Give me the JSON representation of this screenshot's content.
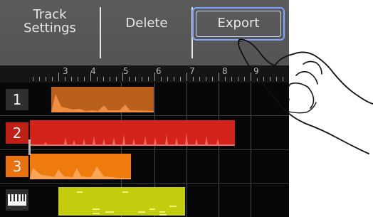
{
  "toolbar": {
    "track_settings_line1": "Track",
    "track_settings_line2": "Settings",
    "delete_label": "Delete",
    "export_label": "Export"
  },
  "ruler": {
    "markers": [
      "3",
      "4",
      "5",
      "6",
      "7",
      "8",
      "9"
    ]
  },
  "tracks": [
    {
      "label": "1",
      "color": "#b65a17"
    },
    {
      "label": "2",
      "color": "#d8261b"
    },
    {
      "label": "3",
      "color": "#ef7a0a"
    },
    {
      "label": "keyboard-icon",
      "color": "#c8d10c"
    }
  ]
}
